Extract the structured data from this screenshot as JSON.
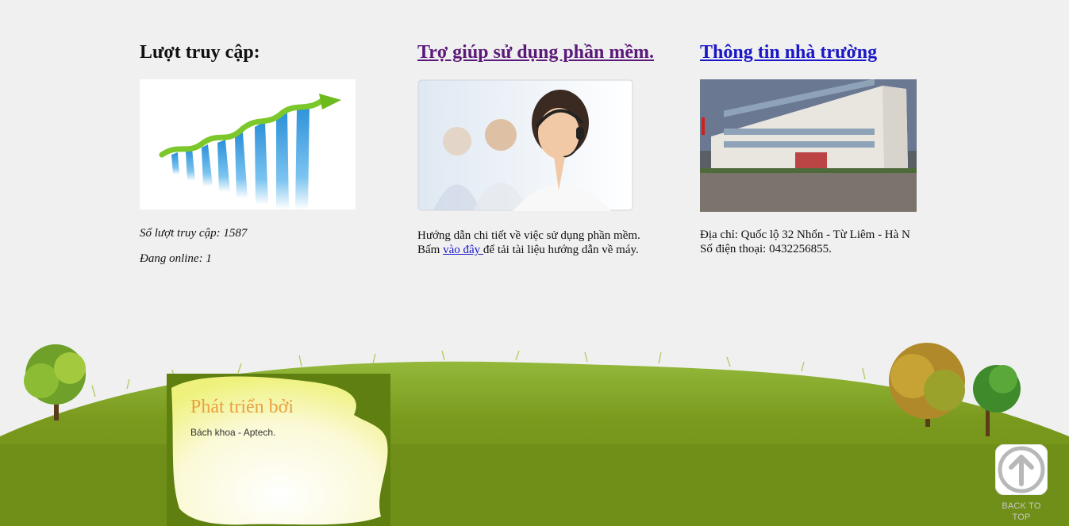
{
  "visits": {
    "heading": "Lượt truy cập:",
    "count_text": "Số lượt truy cập: 1587",
    "online_text": "Đang online: 1"
  },
  "help": {
    "heading": "Trợ giúp sử dụng phần mềm.",
    "line1": "Hướng dẫn chi tiết về việc sử dụng phần mềm.",
    "line2_prefix": "Bấm ",
    "link_text": "vào đây ",
    "line2_suffix": "để tải tài liệu hướng dẫn về máy."
  },
  "school": {
    "heading": "Thông tin nhà trường",
    "address": "Địa chỉ: Quốc lộ 32 Nhổn - Từ Liêm - Hà N",
    "phone": "Số điện thoại: 0432256855."
  },
  "footer": {
    "credit_title": "Phát triển bởi",
    "credit_text": "Bách khoa - Aptech.",
    "back_to_top_line1": "BACK TO",
    "back_to_top_line2": "TOP"
  },
  "colors": {
    "background": "#f0f0f0",
    "grass": "#7a9a1e",
    "visited_link": "#5b1a7a",
    "link": "#1a17c8",
    "credit_title": "#e8a040"
  }
}
